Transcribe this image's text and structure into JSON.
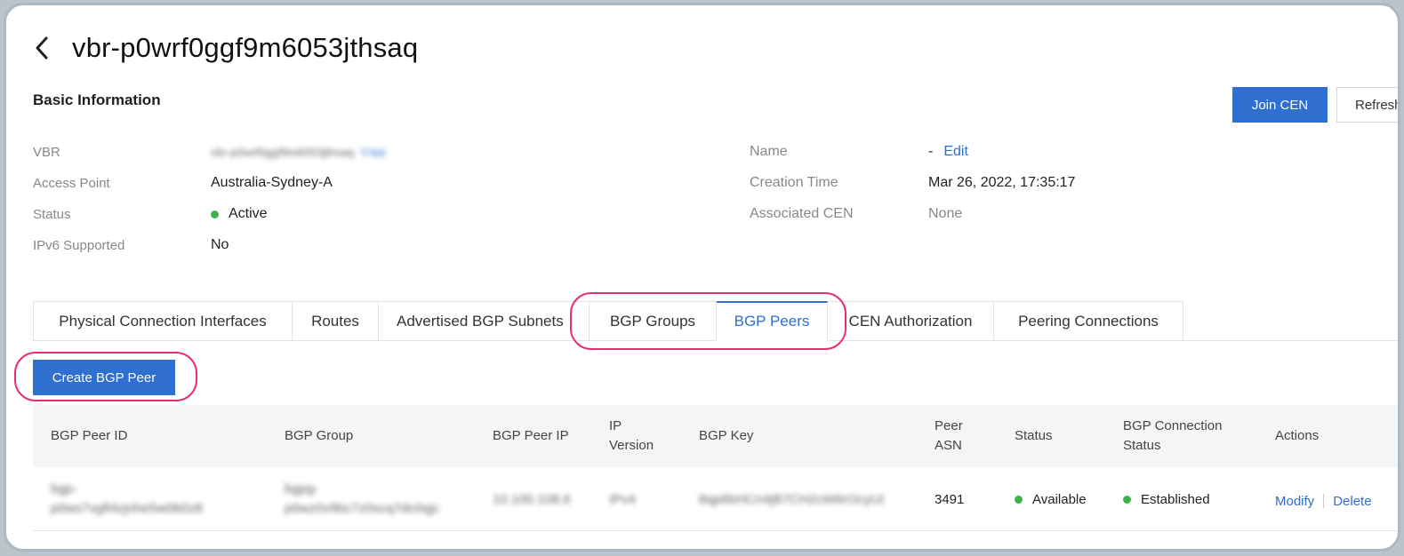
{
  "header": {
    "title": "vbr-p0wrf0ggf9m6053jthsaq"
  },
  "basic_info": {
    "section_title": "Basic Information",
    "join_cen_label": "Join CEN",
    "refresh_label": "Refresh",
    "vbr_label": "VBR",
    "vbr_value": "vbr-p0wrf0ggf9m6053jthsaq",
    "vbr_copy_label": "Copy",
    "access_point_label": "Access Point",
    "access_point_value": "Australia-Sydney-A",
    "status_label": "Status",
    "status_value": "Active",
    "ipv6_label": "IPv6 Supported",
    "ipv6_value": "No",
    "name_label": "Name",
    "name_value": "-",
    "name_edit_label": "Edit",
    "creation_time_label": "Creation Time",
    "creation_time_value": "Mar 26, 2022, 17:35:17",
    "associated_cen_label": "Associated CEN",
    "associated_cen_value": "None"
  },
  "tabs": [
    {
      "label": "Physical Connection Interfaces"
    },
    {
      "label": "Routes"
    },
    {
      "label": "Advertised BGP Subnets"
    },
    {
      "label": "BGP Groups"
    },
    {
      "label": "BGP Peers",
      "active": true
    },
    {
      "label": "CEN Authorization"
    },
    {
      "label": "Peering Connections"
    }
  ],
  "actions": {
    "create_bgp_peer_label": "Create BGP Peer"
  },
  "table": {
    "columns": {
      "peer_id": "BGP Peer ID",
      "group": "BGP Group",
      "peer_ip": "BGP Peer IP",
      "ip_version": "IP\nVersion",
      "key": "BGP Key",
      "peer_asn": "Peer\nASN",
      "status": "Status",
      "conn_status": "BGP Connection\nStatus",
      "actions": "Actions"
    },
    "rows": [
      {
        "peer_id_line1": "bgp-",
        "peer_id_line2": "p0ws7vgfi4zjnhe5w0b0z8",
        "group_line1": "bgpg-",
        "group_line2": "p0wz0v9bc7z0scq7dc0qjc",
        "peer_ip": "10.100.108.6",
        "ip_version": "IPv4",
        "key": "8qp6bHCn4jB7CH2cW6rOcyUI",
        "peer_asn": "3491",
        "status": "Available",
        "conn_status": "Established",
        "modify_label": "Modify",
        "delete_label": "Delete"
      }
    ]
  },
  "colors": {
    "accent": "#2e6fd0",
    "success": "#3bb34a",
    "highlight": "#e8316b"
  }
}
